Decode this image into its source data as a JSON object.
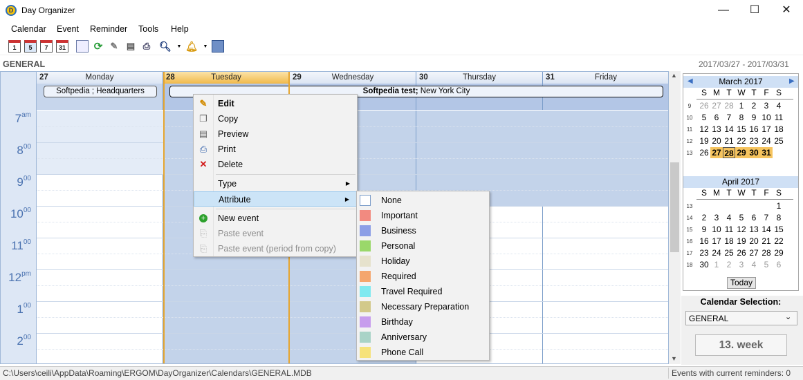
{
  "window": {
    "title": "Day Organizer",
    "min": "—",
    "max": "☐",
    "close": "✕"
  },
  "menubar": [
    "Calendar",
    "Event",
    "Reminder",
    "Tools",
    "Help"
  ],
  "toolbar": {
    "cal1": "1",
    "cal5": "5",
    "cal7": "7",
    "cal31": "31"
  },
  "header": {
    "calendar_name": "GENERAL",
    "date_range": "2017/03/27 - 2017/03/31"
  },
  "days": [
    {
      "num": "27",
      "name": "Monday"
    },
    {
      "num": "28",
      "name": "Tuesday"
    },
    {
      "num": "29",
      "name": "Wednesday"
    },
    {
      "num": "30",
      "name": "Thursday"
    },
    {
      "num": "31",
      "name": "Friday"
    }
  ],
  "events": {
    "e1": "Softpedia ; Headquarters",
    "e2_bold": "Softpedia test;",
    "e2_rest": " New York City"
  },
  "hours": [
    {
      "h": "7",
      "s": "am"
    },
    {
      "h": "8",
      "s": "00"
    },
    {
      "h": "9",
      "s": "00"
    },
    {
      "h": "10",
      "s": "00"
    },
    {
      "h": "11",
      "s": "00"
    },
    {
      "h": "12",
      "s": "pm"
    },
    {
      "h": "1",
      "s": "00"
    },
    {
      "h": "2",
      "s": "00"
    }
  ],
  "context_menu": {
    "edit": "Edit",
    "copy": "Copy",
    "preview": "Preview",
    "print": "Print",
    "delete": "Delete",
    "type": "Type",
    "attribute": "Attribute",
    "new_event": "New event",
    "paste_event": "Paste event",
    "paste_period": "Paste event (period from copy)"
  },
  "attributes": [
    {
      "label": "None",
      "color": "#ffffff"
    },
    {
      "label": "Important",
      "color": "#f28a80"
    },
    {
      "label": "Business",
      "color": "#8c9ee6"
    },
    {
      "label": "Personal",
      "color": "#9ad86a"
    },
    {
      "label": "Holiday",
      "color": "#e6e2cc"
    },
    {
      "label": "Required",
      "color": "#f4a66e"
    },
    {
      "label": "Travel Required",
      "color": "#7fe9f0"
    },
    {
      "label": "Necessary Preparation",
      "color": "#d2c98a"
    },
    {
      "label": "Birthday",
      "color": "#c79ded"
    },
    {
      "label": "Anniversary",
      "color": "#a9d3c7"
    },
    {
      "label": "Phone Call",
      "color": "#f6e27a"
    }
  ],
  "minical": {
    "march_title": "March 2017",
    "april_title": "April 2017",
    "weekdays": [
      "S",
      "M",
      "T",
      "W",
      "T",
      "F",
      "S"
    ],
    "march_weeks": [
      "9",
      "10",
      "11",
      "12",
      "13"
    ],
    "april_weeks": [
      "13",
      "14",
      "15",
      "16",
      "17",
      "18"
    ],
    "today_label": "Today"
  },
  "selection": {
    "label": "Calendar Selection:",
    "value": "GENERAL",
    "week": "13. week"
  },
  "status": {
    "path": "C:\\Users\\ceili\\AppData\\Roaming\\ERGOM\\DayOrganizer\\Calendars\\GENERAL.MDB",
    "reminders": "Events with current reminders: 0"
  },
  "colors": {
    "accent": "#4a72b0",
    "today": "#f1b94a",
    "selection": "#b3c6e6"
  }
}
